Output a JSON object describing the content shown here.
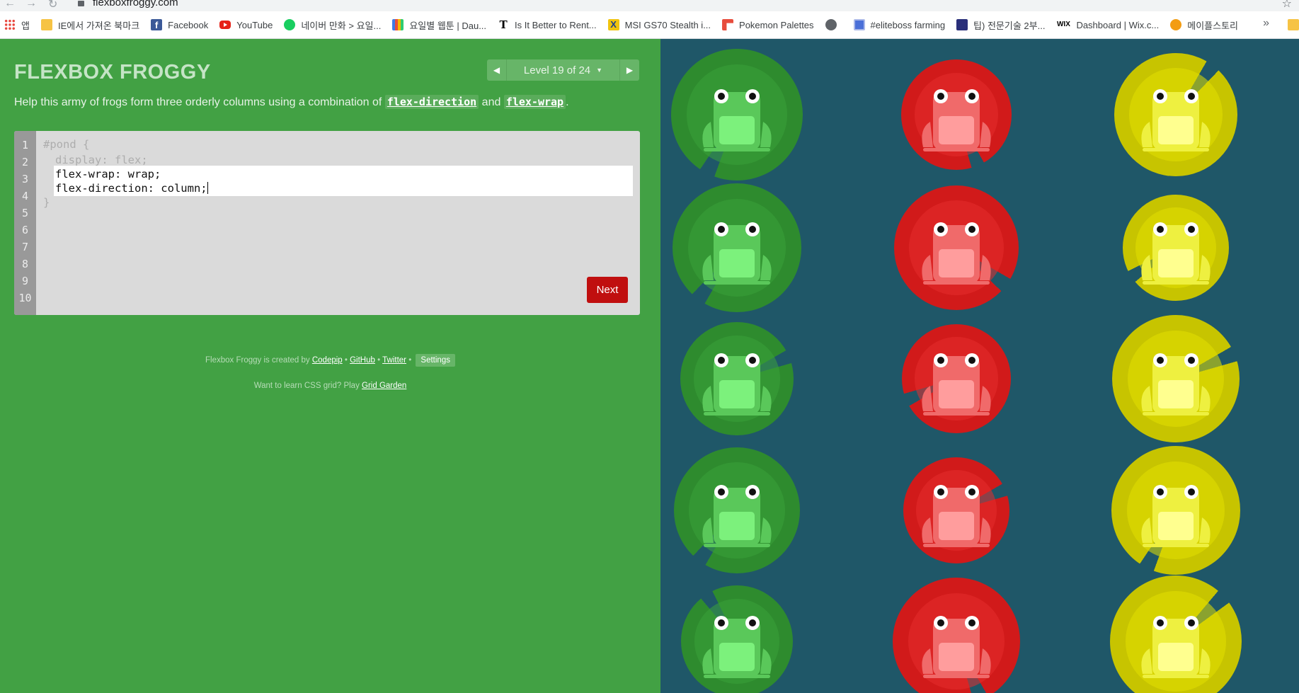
{
  "browser": {
    "url": "flexboxfroggy.com",
    "bookmarks": [
      {
        "label": "앱",
        "icon": "apps-icon"
      },
      {
        "label": "IE에서 가져온 북마크",
        "icon": "folder-icon"
      },
      {
        "label": "Facebook",
        "icon": "facebook-icon"
      },
      {
        "label": "YouTube",
        "icon": "youtube-icon"
      },
      {
        "label": "네이버 만화 > 요일...",
        "icon": "naver-icon"
      },
      {
        "label": "요일별 웹툰 | Dau...",
        "icon": "daum-icon"
      },
      {
        "label": "Is It Better to Rent...",
        "icon": "nyt-icon"
      },
      {
        "label": "MSI GS70 Stealth i...",
        "icon": "msi-icon"
      },
      {
        "label": "Pokemon Palettes",
        "icon": "pokemon-icon"
      },
      {
        "label": "",
        "icon": "globe-icon"
      },
      {
        "label": "#eliteboss farming",
        "icon": "elite-icon"
      },
      {
        "label": "팁) 전문기술 2부...",
        "icon": "tip-icon"
      },
      {
        "label": "Dashboard | Wix.c...",
        "icon": "wix-icon"
      },
      {
        "label": "메이플스토리",
        "icon": "maple-icon"
      }
    ],
    "more_label": "»"
  },
  "game": {
    "title": "FLEXBOX FROGGY",
    "level_label": "Level 19 of 24",
    "prev_label": "◀",
    "next_label": "▶",
    "instructions": {
      "before": "Help this army of frogs form three orderly columns using a combination of ",
      "code1": "flex-direction",
      "middle": " and ",
      "code2": "flex-wrap",
      "after": "."
    },
    "editor": {
      "line_numbers": [
        "1",
        "2",
        "3",
        "4",
        "5",
        "6",
        "7",
        "8",
        "9",
        "10"
      ],
      "line1": "#pond {",
      "line2": "display: flex;",
      "input_line1": "flex-wrap: wrap;",
      "input_line2": "flex-direction: column;",
      "line5": "}"
    },
    "next_button": "Next",
    "footer": {
      "created_by": "Flexbox Froggy is created by ",
      "codepip": "Codepip",
      "sep": " • ",
      "github": "GitHub",
      "twitter": "Twitter",
      "settings": "Settings",
      "grid_text": "Want to learn CSS grid? Play ",
      "grid_link": "Grid Garden"
    }
  },
  "pond": {
    "columns": [
      "green",
      "red",
      "yellow"
    ],
    "frogs_per_column": 5,
    "colors": {
      "green": {
        "pad": "#2e8b2e",
        "pad_inner": "#3aa33a",
        "frog": "#5ac85a",
        "belly": "#7cf17c"
      },
      "red": {
        "pad": "#d11a1a",
        "pad_inner": "#e52d2d",
        "frog": "#f06a6a",
        "belly": "#ff9d9d"
      },
      "yellow": {
        "pad": "#c7c400",
        "pad_inner": "#e2e000",
        "frog": "#eef040",
        "belly": "#ffff8f"
      },
      "background": "#1f5768"
    }
  }
}
